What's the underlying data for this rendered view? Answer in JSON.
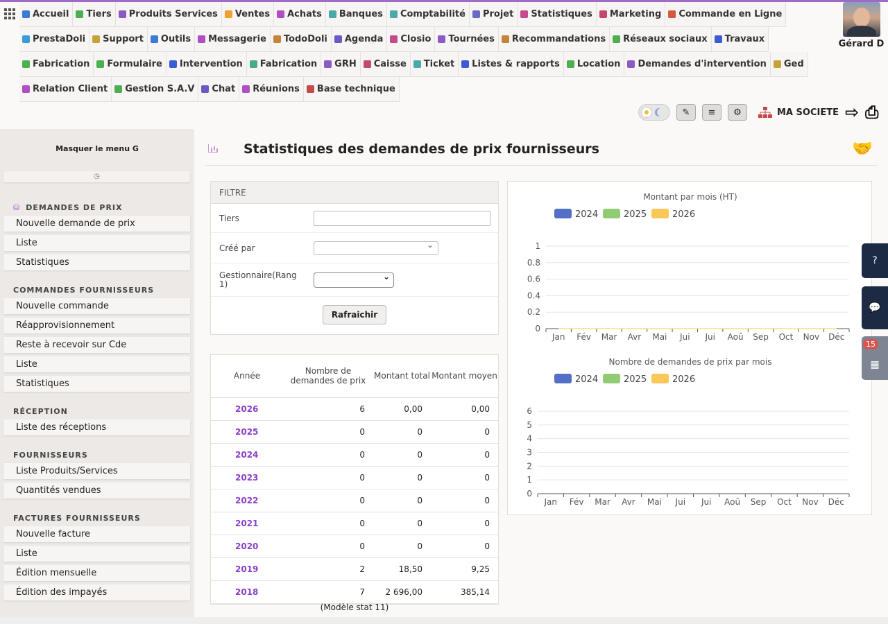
{
  "menu": [
    {
      "label": "Accueil",
      "color": "#3b7bd4"
    },
    {
      "label": "Tiers",
      "color": "#4caf50"
    },
    {
      "label": "Produits Services",
      "color": "#8d5ac4"
    },
    {
      "label": "Ventes",
      "color": "#f0a030"
    },
    {
      "label": "Achats",
      "color": "#b04ec4"
    },
    {
      "label": "Banques",
      "color": "#4aa9a9"
    },
    {
      "label": "Comptabilité",
      "color": "#4aa9a9"
    },
    {
      "label": "Projet",
      "color": "#6a6ac4"
    },
    {
      "label": "Statistiques",
      "color": "#c44a8a"
    },
    {
      "label": "Marketing",
      "color": "#c44a6a"
    },
    {
      "label": "Commande en Ligne",
      "color": "#d45a3a"
    },
    {
      "label": "PrestaDoli",
      "color": "#3b9bd4"
    },
    {
      "label": "Support",
      "color": "#c4a43a"
    },
    {
      "label": "Outils",
      "color": "#3b7bd4"
    },
    {
      "label": "Messagerie",
      "color": "#b04ec4"
    },
    {
      "label": "TodoDoli",
      "color": "#c4843a"
    },
    {
      "label": "Agenda",
      "color": "#6a5ac4"
    },
    {
      "label": "Closio",
      "color": "#c44a8a"
    },
    {
      "label": "Tournées",
      "color": "#8d5ac4"
    },
    {
      "label": "Recommandations",
      "color": "#c4843a"
    },
    {
      "label": "Réseaux sociaux",
      "color": "#4caf50"
    },
    {
      "label": "Travaux",
      "color": "#3b5bd4"
    },
    {
      "label": "Fabrication",
      "color": "#4caf50"
    },
    {
      "label": "Formulaire",
      "color": "#4caf50"
    },
    {
      "label": "Intervention",
      "color": "#3b5bd4"
    },
    {
      "label": "Fabrication",
      "color": "#4aa98a"
    },
    {
      "label": "GRH",
      "color": "#8d5ac4"
    },
    {
      "label": "Caisse",
      "color": "#c44a6a"
    },
    {
      "label": "Ticket",
      "color": "#4aa9a9"
    },
    {
      "label": "Listes & rapports",
      "color": "#3b5bd4"
    },
    {
      "label": "Location",
      "color": "#4caf50"
    },
    {
      "label": "Demandes d'intervention",
      "color": "#8d5ac4"
    },
    {
      "label": "Ged",
      "color": "#c4a43a"
    },
    {
      "label": "Relation Client",
      "color": "#b04ec4"
    },
    {
      "label": "Gestion S.A.V",
      "color": "#4caf50"
    },
    {
      "label": "Chat",
      "color": "#6a5ac4"
    },
    {
      "label": "Réunions",
      "color": "#b04ec4"
    },
    {
      "label": "Base technique",
      "color": "#c44a4a"
    }
  ],
  "user": {
    "name": "Gérard D"
  },
  "toolbar": {
    "company": "MA SOCIETE"
  },
  "sidebar": {
    "hide_label": "Masquer le menu G",
    "sections": [
      {
        "title": "DEMANDES DE PRIX",
        "items": [
          "Nouvelle demande de prix",
          "Liste",
          "Statistiques"
        ]
      },
      {
        "title": "COMMANDES FOURNISSEURS",
        "items": [
          "Nouvelle commande",
          "Réapprovisionnement",
          "Reste à recevoir sur Cde",
          "Liste",
          "Statistiques"
        ]
      },
      {
        "title": "RÉCEPTION",
        "items": [
          "Liste des réceptions"
        ]
      },
      {
        "title": "FOURNISSEURS",
        "items": [
          "Liste Produits/Services",
          "Quantités vendues"
        ]
      },
      {
        "title": "FACTURES FOURNISSEURS",
        "items": [
          "Nouvelle facture",
          "Liste",
          "Édition mensuelle",
          "Édition des impayés"
        ]
      }
    ]
  },
  "page": {
    "title": "Statistiques des demandes de prix fournisseurs"
  },
  "filter": {
    "header": "FILTRE",
    "tiers_label": "Tiers",
    "tiers_value": "",
    "created_by_label": "Créé par",
    "manager_label": "Gestionnaire(Rang 1)",
    "refresh_label": "Rafraichir"
  },
  "stats": {
    "headers": [
      "Année",
      "Nombre de demandes de prix",
      "Montant total",
      "Montant moyen"
    ],
    "rows": [
      {
        "year": "2026",
        "count": "6",
        "total": "0,00",
        "avg": "0,00"
      },
      {
        "year": "2025",
        "count": "0",
        "total": "0",
        "avg": "0"
      },
      {
        "year": "2024",
        "count": "0",
        "total": "0",
        "avg": "0"
      },
      {
        "year": "2023",
        "count": "0",
        "total": "0",
        "avg": "0"
      },
      {
        "year": "2022",
        "count": "0",
        "total": "0",
        "avg": "0"
      },
      {
        "year": "2021",
        "count": "0",
        "total": "0",
        "avg": "0"
      },
      {
        "year": "2020",
        "count": "0",
        "total": "0",
        "avg": "0"
      },
      {
        "year": "2019",
        "count": "2",
        "total": "18,50",
        "avg": "9,25"
      },
      {
        "year": "2018",
        "count": "7",
        "total": "2 696,00",
        "avg": "385,14"
      }
    ],
    "footer": "(Modèle stat 11)"
  },
  "side_buttons": {
    "badge": "15"
  },
  "chart_data": [
    {
      "type": "line",
      "title": "Montant par mois (HT)",
      "categories": [
        "Jan",
        "Fév",
        "Mar",
        "Avr",
        "Mai",
        "Jui",
        "Jui",
        "Aoû",
        "Sep",
        "Oct",
        "Nov",
        "Déc"
      ],
      "yticks": [
        "0",
        "0.2",
        "0.4",
        "0.6",
        "0.8",
        "1"
      ],
      "ylim": [
        0,
        1
      ],
      "legend_position": "top",
      "series": [
        {
          "name": "2024",
          "color": "#5470c6",
          "values": [
            0,
            0,
            0,
            0,
            0,
            0,
            0,
            0,
            0,
            0,
            0,
            0
          ]
        },
        {
          "name": "2025",
          "color": "#91cc75",
          "values": [
            0,
            0,
            0,
            0,
            0,
            0,
            0,
            0,
            0,
            0,
            0,
            0
          ]
        },
        {
          "name": "2026",
          "color": "#fac858",
          "values": [
            0,
            0,
            0,
            0,
            0,
            0,
            0,
            0,
            0,
            0,
            0,
            0
          ]
        }
      ]
    },
    {
      "type": "bar",
      "title": "Nombre de demandes de prix par mois",
      "categories": [
        "Jan",
        "Fév",
        "Mar",
        "Avr",
        "Mai",
        "Jui",
        "Jui",
        "Aoû",
        "Sep",
        "Oct",
        "Nov",
        "Déc"
      ],
      "yticks": [
        "0",
        "1",
        "2",
        "3",
        "4",
        "5",
        "6"
      ],
      "ylim": [
        0,
        6
      ],
      "legend_position": "top",
      "series": [
        {
          "name": "2024",
          "color": "#5470c6",
          "values": [
            0,
            0,
            0,
            0,
            0,
            0,
            0,
            0,
            0,
            0,
            0,
            0
          ]
        },
        {
          "name": "2025",
          "color": "#91cc75",
          "values": [
            0,
            0,
            0,
            0,
            0,
            0,
            0,
            0,
            0,
            0,
            0,
            0
          ]
        },
        {
          "name": "2026",
          "color": "#fac858",
          "values": [
            0,
            0,
            0,
            0,
            0,
            0,
            0,
            0,
            0,
            0,
            0,
            0
          ]
        }
      ]
    }
  ]
}
